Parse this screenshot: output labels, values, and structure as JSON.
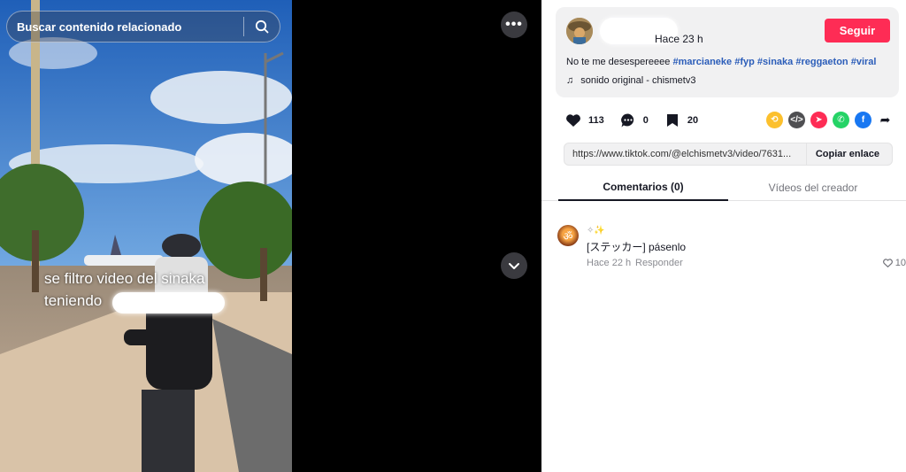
{
  "search": {
    "placeholder": "Buscar contenido relacionado"
  },
  "video": {
    "caption_line1": "se filtro video del sinaka",
    "caption_line2": "teniendo"
  },
  "author": {
    "posted": "Hace 23 h",
    "follow_label": "Seguir"
  },
  "description": {
    "text": "No te me desespereeee",
    "hashtags": [
      "#marcianeke",
      "#fyp",
      "#sinaka",
      "#reggaeton",
      "#viral"
    ]
  },
  "music": {
    "label": "sonido original - chismetv3"
  },
  "actions": {
    "likes": "113",
    "comments": "0",
    "saves": "20"
  },
  "share": {
    "icons": [
      "repost-icon",
      "embed-icon",
      "send-icon",
      "whatsapp-icon",
      "facebook-icon",
      "share-arrow-icon"
    ],
    "colors": {
      "repost": "#fcc02d",
      "embed": "#4f4f52",
      "send": "#fe2c55",
      "whatsapp": "#25d366",
      "facebook": "#1877f2"
    }
  },
  "link": {
    "url": "https://www.tiktok.com/@elchismetv3/video/7631...",
    "copy_label": "Copiar enlace"
  },
  "tabs": [
    {
      "label": "Comentarios (0)",
      "active": true
    },
    {
      "label": "Vídeos del creador",
      "active": false
    }
  ],
  "comments": [
    {
      "text": "[ステッカー] pásenlo",
      "time": "Hace 22 h",
      "reply_label": "Responder",
      "likes": "10"
    }
  ],
  "colors": {
    "accent": "#fe2c55",
    "hashtag": "#2b5db9"
  }
}
